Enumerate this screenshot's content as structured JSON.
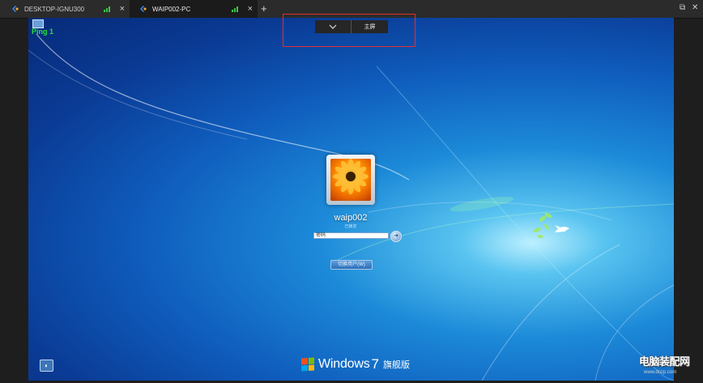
{
  "tabs": [
    {
      "label": "DESKTOP-IGNU300",
      "close": "×",
      "active": false
    },
    {
      "label": "WAIP002-PC",
      "close": "×",
      "active": true
    }
  ],
  "add_tab": "+",
  "window_controls": {
    "restore": "⧉",
    "close": "✕"
  },
  "ping": {
    "label": "Ping 1"
  },
  "float_toolbar": {
    "collapse_icon": "chevron-down",
    "main_screen": "主屏"
  },
  "login": {
    "username": "waip002",
    "status": "已锁定",
    "password_placeholder": "密码",
    "switch_user": "切换用户(W)"
  },
  "brand": {
    "name": "Windows",
    "version": "7",
    "edition": "旗舰版"
  },
  "watermark": {
    "line1": "电脑装配网",
    "line2": "www.dnzp.com"
  },
  "colors": {
    "tabbar_bg": "#2b2b2b",
    "active_tab_bg": "#1b1b1b",
    "signal_green": "#3cc24a",
    "ping_green": "#26e040",
    "highlight_box": "#e03030",
    "float_toolbar_bg": "#262626"
  }
}
